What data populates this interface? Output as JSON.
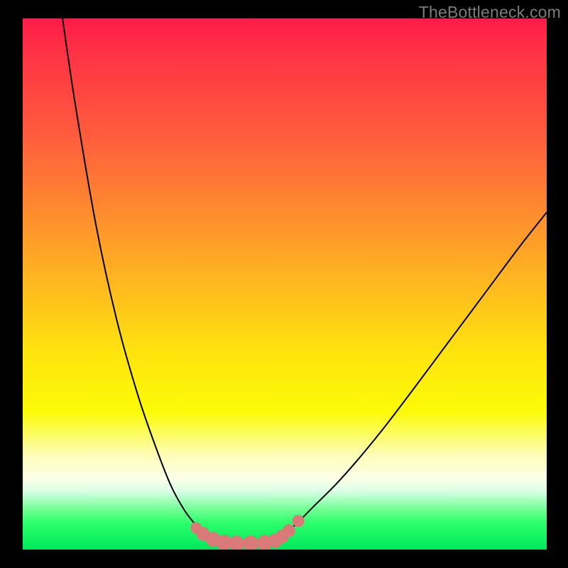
{
  "watermark": "TheBottleneck.com",
  "colors": {
    "page_bg": "#000000",
    "watermark": "#7c7c7c",
    "curve": "#000000",
    "dot": "#d97a78",
    "gradient_top": "#ff1b49",
    "gradient_bottom": "#00e85a"
  },
  "chart_data": {
    "type": "line",
    "title": "",
    "xlabel": "",
    "ylabel": "",
    "xlim": [
      0,
      100
    ],
    "ylim": [
      0,
      100
    ],
    "grid": false,
    "legend_position": "none",
    "note": "V-shaped bottleneck curve over a red→green vertical gradient. Axis values are estimated from pixel positions; no tick labels are visible.",
    "series": [
      {
        "name": "left-curve",
        "x": [
          7.6,
          10,
          14,
          18,
          22,
          25.5,
          28.3,
          30.8,
          32.7,
          34.3,
          35.7,
          37.1
        ],
        "y": [
          100,
          84,
          61,
          43,
          29,
          19,
          12,
          7.5,
          5,
          3.3,
          2.3,
          1.7
        ]
      },
      {
        "name": "right-curve",
        "x": [
          47.6,
          49,
          50.7,
          52.7,
          55.4,
          59.5,
          63.6,
          69,
          74.4,
          81.2,
          88,
          94.8,
          100
        ],
        "y": [
          1.5,
          2.3,
          3.5,
          5.3,
          8,
          12,
          16.5,
          23,
          30,
          39,
          48,
          57,
          63.5
        ]
      },
      {
        "name": "valley-floor",
        "x": [
          37.1,
          38.4,
          40.8,
          43.5,
          46.2,
          47.6
        ],
        "y": [
          1.7,
          1.35,
          1.2,
          1.2,
          1.3,
          1.5
        ]
      }
    ],
    "points": {
      "name": "highlight-dots",
      "x": [
        33.1,
        34.4,
        36.3,
        38.4,
        40.8,
        43.5,
        46.2,
        48.2,
        49.5,
        50.8,
        52.6
      ],
      "y": [
        4.1,
        3.0,
        2.0,
        1.35,
        1.2,
        1.2,
        1.3,
        1.7,
        2.5,
        3.6,
        5.4
      ],
      "r": [
        8,
        9.5,
        10.5,
        11,
        11,
        11,
        11,
        10,
        9.5,
        9,
        8.5
      ]
    }
  }
}
